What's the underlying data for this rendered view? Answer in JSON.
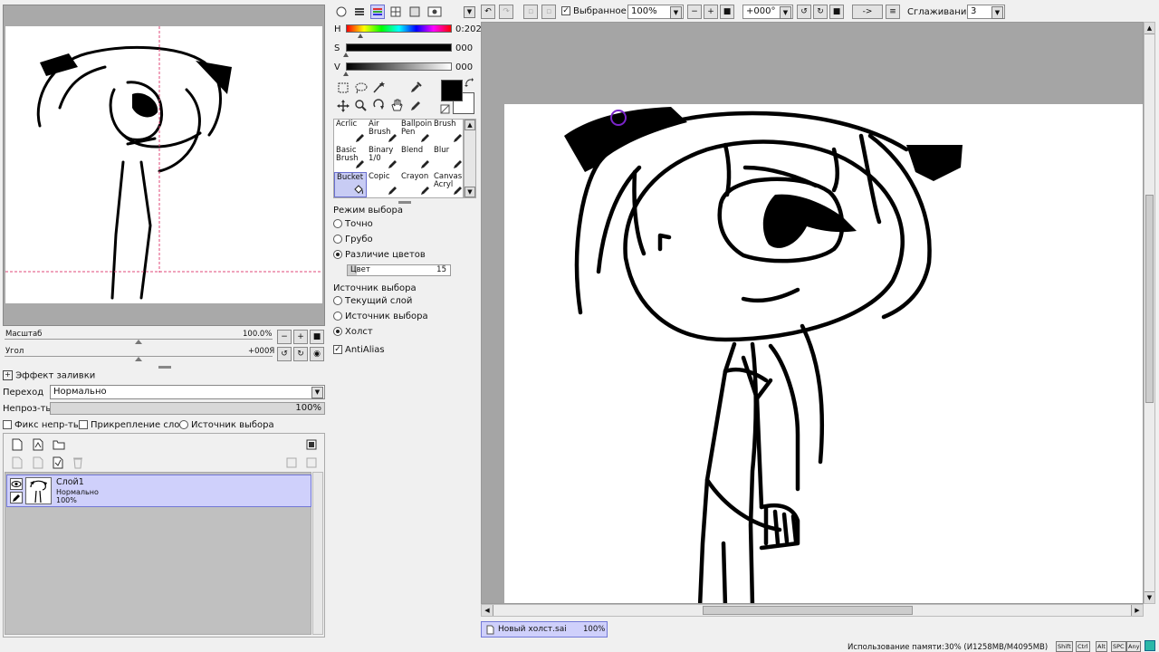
{
  "navigator": {
    "zoom_label": "Масштаб",
    "zoom_value": "100.0%",
    "angle_label": "Угол",
    "angle_value": "+000Я"
  },
  "fill_effect": {
    "title": "Эффект заливки",
    "blend_label": "Переход",
    "blend_value": "Нормально",
    "opacity_label": "Непроз-ть",
    "opacity_value": "100%",
    "opacity_fraction": 1.0,
    "lock_opacity": "Фикс непр-ть",
    "clip_layer": "Прикрепление слоя",
    "selection_source": "Источник выбора"
  },
  "layers": [
    {
      "name": "Слой1",
      "mode": "Нормально",
      "opacity": "100%"
    }
  ],
  "color": {
    "h_label": "H",
    "h_value": "0:202",
    "s_label": "S",
    "s_value": "000",
    "v_label": "V",
    "v_value": "000",
    "primary": "#000000",
    "secondary": "#ffffff"
  },
  "brushes": [
    {
      "name": "Acrlic"
    },
    {
      "name": "Air Brush"
    },
    {
      "name": "Ballpoint Pen"
    },
    {
      "name": "Brush"
    },
    {
      "name": "Basic Brush"
    },
    {
      "name": "Binary 1/0"
    },
    {
      "name": "Blend"
    },
    {
      "name": "Blur"
    },
    {
      "name": "Bucket"
    },
    {
      "name": "Copic"
    },
    {
      "name": "Crayon"
    },
    {
      "name": "Canvas Acryl"
    }
  ],
  "tool_options": {
    "select_mode_title": "Режим выбора",
    "mode_exact": "Точно",
    "mode_rough": "Грубо",
    "mode_color_diff": "Различие цветов",
    "color_field_label": "Цвет",
    "color_field_value": "15",
    "source_title": "Источник выбора",
    "source_current": "Текущий слой",
    "source_selection": "Источник выбора",
    "source_canvas": "Холст",
    "antialias": "AntiAlias"
  },
  "toolbar": {
    "selection_label": "Выбранное",
    "zoom_value": "100%",
    "angle_value": "+000°",
    "flip_label": "->",
    "smoothing_label": "Сглаживание",
    "smoothing_value": "3"
  },
  "document_tab": {
    "name": "Новый холст.sai",
    "zoom": "100%"
  },
  "status_bar": {
    "memory": "Использование памяти:30% (И1258MB/M4095MB)",
    "keys": [
      "Shift",
      "Ctrl",
      "Alt",
      "SPC",
      "Any"
    ]
  }
}
